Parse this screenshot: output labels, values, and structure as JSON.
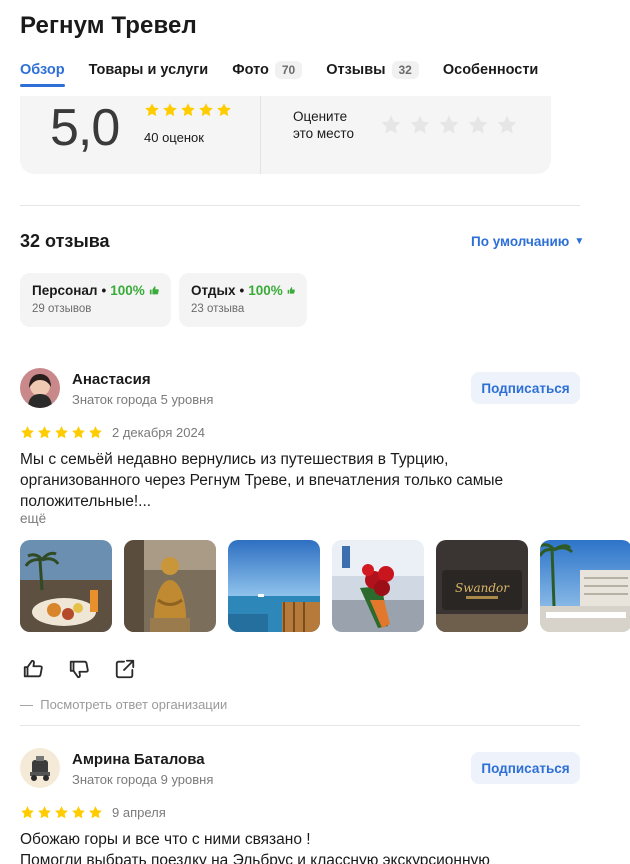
{
  "page": {
    "title": "Регнум Тревел"
  },
  "tabs": [
    {
      "label": "Обзор",
      "count": null,
      "active": true
    },
    {
      "label": "Товары и услуги",
      "count": null,
      "active": false
    },
    {
      "label": "Фото",
      "count": "70",
      "active": false
    },
    {
      "label": "Отзывы",
      "count": "32",
      "active": false
    },
    {
      "label": "Особенности",
      "count": null,
      "active": false
    }
  ],
  "rating": {
    "score": "5,0",
    "stars_filled": 5,
    "count_label": "40 оценок",
    "rate_prompt_line1": "Оцените",
    "rate_prompt_line2": "это место",
    "rate_stars": 5
  },
  "reviews_header": {
    "count_label": "32 отзыва",
    "sort_label": "По умолчанию"
  },
  "aspects": [
    {
      "name": "Персонал",
      "percent": "100%",
      "reviews": "29 отзывов"
    },
    {
      "name": "Отдых",
      "percent": "100%",
      "reviews": "23 отзыва"
    }
  ],
  "reviews": [
    {
      "author": "Анастасия",
      "level": "Знаток города 5 уровня",
      "subscribe_label": "Подписаться",
      "stars": 5,
      "date": "2 декабря 2024",
      "text_line1": "Мы с семьёй недавно вернулись из путешествия в Турцию,",
      "text_line2": "организованного через Регнум Треве, и впечатления только самые",
      "text_line3": "положительные!...",
      "more_label": "ещё",
      "photo_count": 6,
      "org_answer_label": "Посмотреть ответ организации"
    },
    {
      "author": "Амрина Баталова",
      "level": "Знаток города 9 уровня",
      "subscribe_label": "Подписаться",
      "stars": 5,
      "date": "9 апреля",
      "text_line1": "Обожаю горы и все что с ними связано !",
      "text_line2": "Помогли выбрать поездку на Эльбрус и классную экскурсионную"
    }
  ],
  "icons": {
    "like": "thumbs-up-icon",
    "dislike": "thumbs-down-icon",
    "share": "share-icon",
    "star": "star-icon",
    "sort": "caret-down-icon"
  },
  "colors": {
    "accent": "#2d6fd6",
    "star": "#ffcc00",
    "star_empty": "#e6e6e6",
    "positive": "#3aab3a"
  }
}
